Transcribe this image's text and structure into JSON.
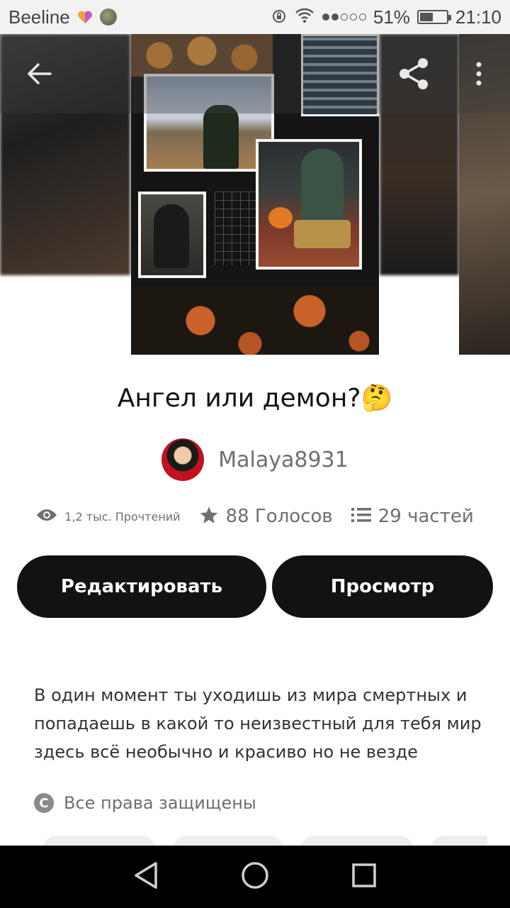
{
  "status_bar": {
    "carrier": "Beeline",
    "battery_percent": "51%",
    "battery_level": 0.51,
    "time": "21:10",
    "icons": [
      "heart-badge-icon",
      "avatar",
      "alarm-icon",
      "wifi-icon",
      "signal-dots-icon",
      "battery-icon"
    ]
  },
  "top_bar": {
    "icons": [
      "back-arrow-icon",
      "share-icon",
      "more-vert-icon"
    ]
  },
  "story": {
    "title": "Ангел или демон?🤔",
    "author": "Malaya8931",
    "stats": {
      "reads": "1,2 тыс. Прочтений",
      "votes": "88 Голосов",
      "parts": "29 частей"
    },
    "buttons": {
      "edit": "Редактировать",
      "view": "Просмотр"
    },
    "description": "В один момент ты уходишь из мира смертных и попадаешь в какой то неизвестный для тебя мир здесь всё необычно и красиво но не везде",
    "copyright_icon": "C",
    "copyright": "Все права защищены"
  },
  "colors": {
    "primary_button": "#121212",
    "text_dark": "#121212",
    "text_muted": "#6f6f6f",
    "nav_bar": "#000000",
    "avatar_ring": "#c1121f"
  },
  "nav_bar": {
    "icons": [
      "back-triangle-icon",
      "home-circle-icon",
      "recents-square-icon"
    ]
  }
}
